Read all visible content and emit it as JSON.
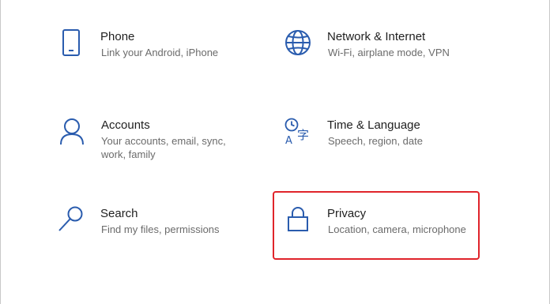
{
  "settings": {
    "tiles": [
      {
        "title": "Phone",
        "desc": "Link your Android, iPhone",
        "icon": "phone-icon"
      },
      {
        "title": "Network & Internet",
        "desc": "Wi-Fi, airplane mode, VPN",
        "icon": "globe-icon"
      },
      {
        "title": "Accounts",
        "desc": "Your accounts, email, sync,\nwork, family",
        "icon": "person-icon"
      },
      {
        "title": "Time & Language",
        "desc": "Speech, region, date",
        "icon": "time-language-icon"
      },
      {
        "title": "Search",
        "desc": "Find my files, permissions",
        "icon": "search-icon"
      },
      {
        "title": "Privacy",
        "desc": "Location, camera, microphone",
        "icon": "lock-icon"
      }
    ]
  },
  "colors": {
    "icon_blue": "#2a5cae",
    "title_text": "#1f1f1f",
    "description_text": "#6b6b6b",
    "highlight_red": "#e0242b"
  }
}
